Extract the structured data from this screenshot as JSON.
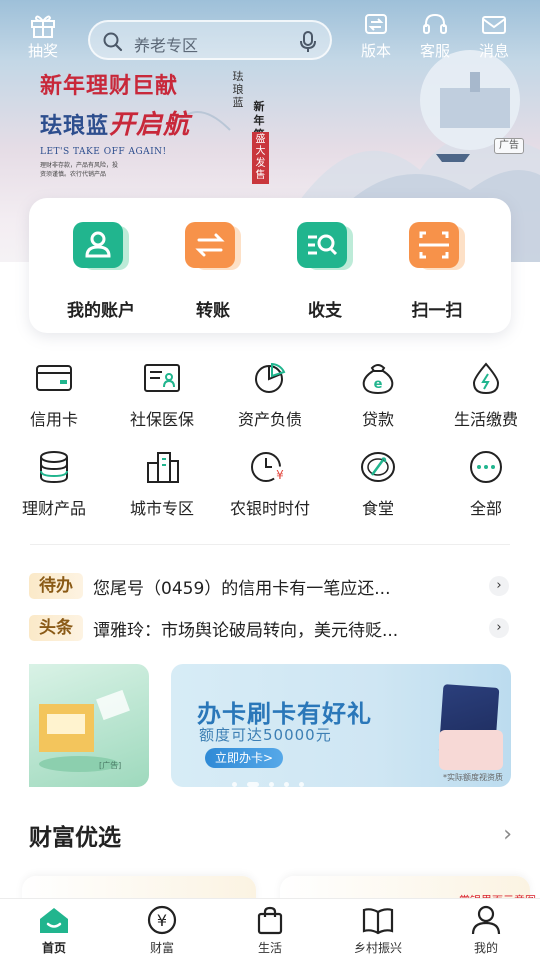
{
  "topbar": {
    "lottery": "抽奖",
    "search_placeholder": "养老专区",
    "version": "版本",
    "service": "客服",
    "messages": "消息"
  },
  "banner": {
    "line1": "新年理财巨献",
    "line2_blue": "珐琅蓝",
    "line2_red": "开启航",
    "english": "LET'S TAKE OFF AGAIN!",
    "small": "理财非存款，产品有风险，投资须谨慎。农行代销产品",
    "vertical1": "珐琅蓝",
    "vertical2": "新年第一期",
    "stamp": "盛大发售",
    "ad_tag": "广告"
  },
  "quick_actions": [
    {
      "label": "我的账户",
      "icon": "account-icon"
    },
    {
      "label": "转账",
      "icon": "transfer-icon"
    },
    {
      "label": "收支",
      "icon": "income-expense-icon"
    },
    {
      "label": "扫一扫",
      "icon": "scan-icon"
    }
  ],
  "services": [
    {
      "label": "信用卡",
      "icon": "credit-card-icon"
    },
    {
      "label": "社保医保",
      "icon": "social-security-icon"
    },
    {
      "label": "资产负债",
      "icon": "pie-chart-icon"
    },
    {
      "label": "贷款",
      "icon": "loan-bag-icon"
    },
    {
      "label": "生活缴费",
      "icon": "utility-drop-icon"
    },
    {
      "label": "理财产品",
      "icon": "coin-stack-icon"
    },
    {
      "label": "城市专区",
      "icon": "city-building-icon"
    },
    {
      "label": "农银时时付",
      "icon": "clock-yuan-icon"
    },
    {
      "label": "食堂",
      "icon": "canteen-icon"
    },
    {
      "label": "全部",
      "icon": "more-icon"
    }
  ],
  "news": [
    {
      "tag": "待办",
      "text": "您尾号（0459）的信用卡有一笔应还..."
    },
    {
      "tag": "头条",
      "text": "谭雅玲：市场舆论破局转向，美元待贬..."
    }
  ],
  "promo": {
    "left_ad": "[广告]",
    "title": "办卡刷卡有好礼",
    "subtitle": "额度可达50000元",
    "button": "立即办卡>",
    "note": "*实际额度视资质"
  },
  "wealth": {
    "title": "财富优选",
    "arrow": "›"
  },
  "watermark": "掌银界面示意图",
  "tabs": [
    {
      "label": "首页",
      "icon": "home-icon"
    },
    {
      "label": "财富",
      "icon": "wealth-yen-icon"
    },
    {
      "label": "生活",
      "icon": "shopping-bag-icon"
    },
    {
      "label": "乡村振兴",
      "icon": "book-icon"
    },
    {
      "label": "我的",
      "icon": "profile-icon"
    }
  ],
  "colors": {
    "brand_green": "#21b58e",
    "accent_orange": "#f7924a",
    "tag_gold": "#8a5a16"
  }
}
